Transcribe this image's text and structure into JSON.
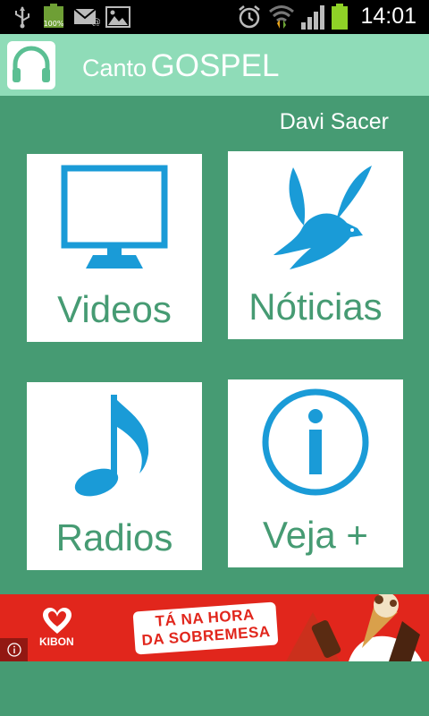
{
  "status_bar": {
    "time": "14:01",
    "battery_level": "100%",
    "icons": [
      "usb-icon",
      "battery-icon",
      "email-icon",
      "gallery-icon",
      "alarm-icon",
      "wifi-icon",
      "signal-icon",
      "battery-icon"
    ]
  },
  "header": {
    "title_small": "Canto",
    "title_large": "GOSPEL",
    "logo_icon": "headphones-icon"
  },
  "artist_name": "Davi Sacer",
  "tiles": [
    {
      "label": "Videos",
      "icon": "monitor-icon"
    },
    {
      "label": "Nóticias",
      "icon": "dove-icon"
    },
    {
      "label": "Radios",
      "icon": "music-note-icon"
    },
    {
      "label": "Veja +",
      "icon": "info-icon"
    }
  ],
  "ad": {
    "brand": "KIBON",
    "slogan_line1": "TÁ NA HORA",
    "slogan_line2": "DA SOBREMESA",
    "info_icon": "info-icon"
  },
  "colors": {
    "background": "#469b73",
    "header": "#8fdcb8",
    "icon_blue": "#1a9bd7",
    "ad_red": "#e1261c"
  }
}
